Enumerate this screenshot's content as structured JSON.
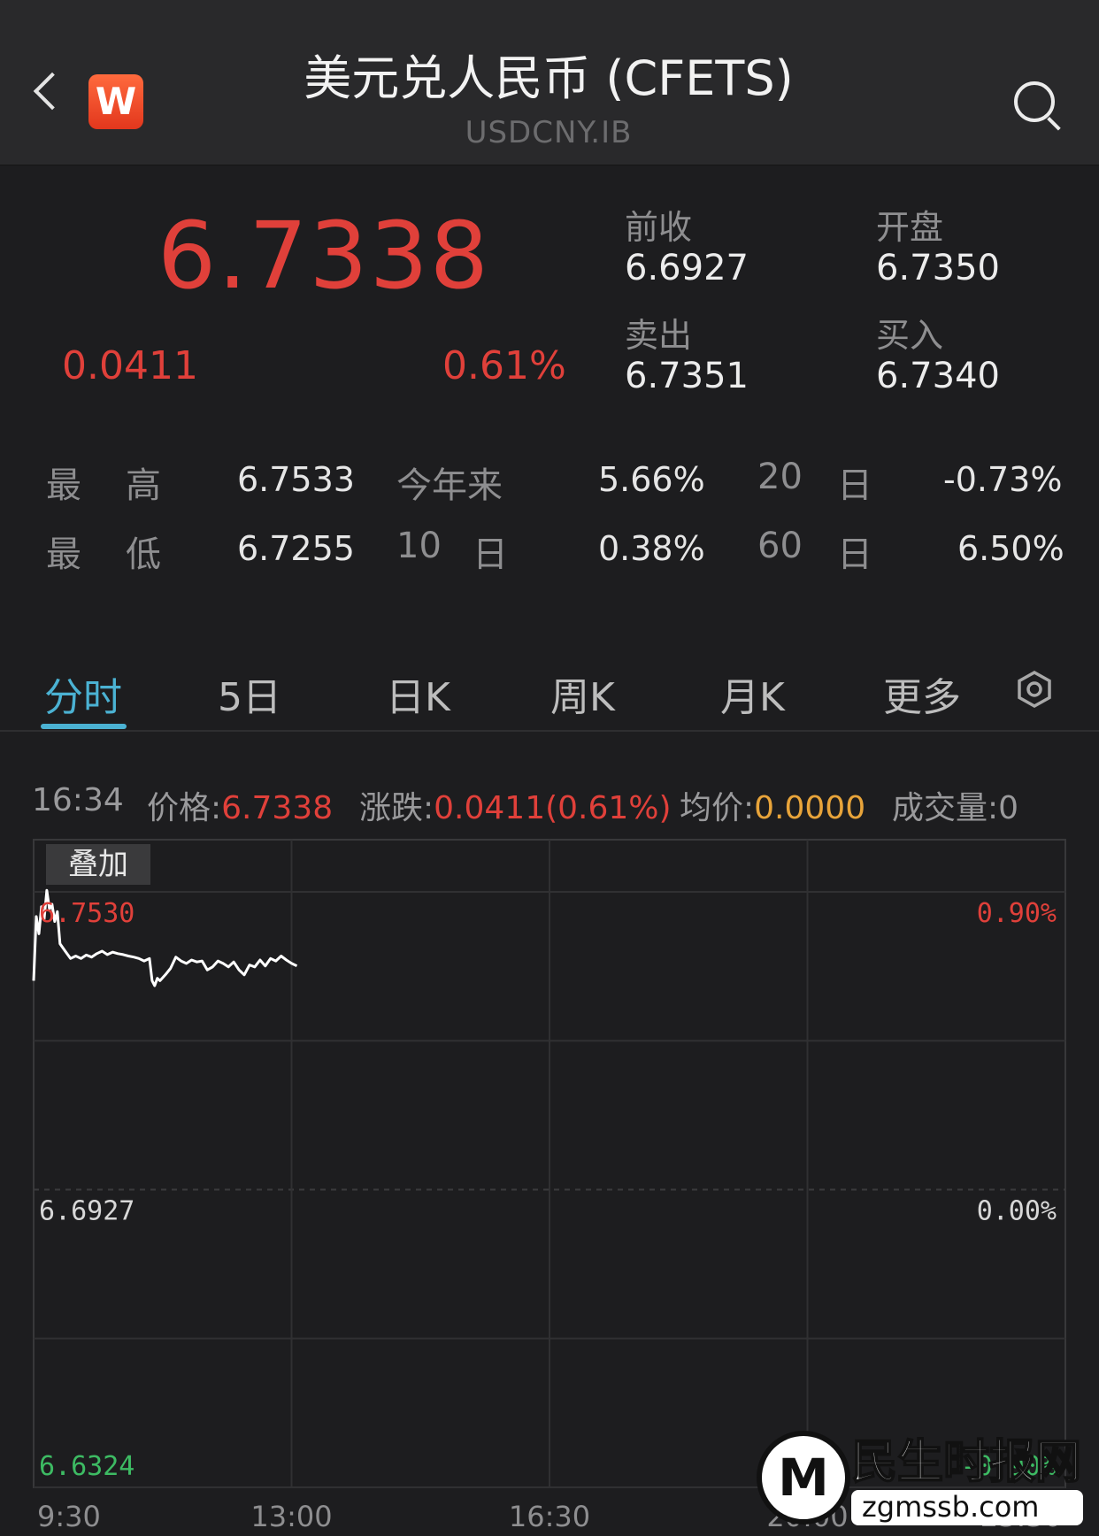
{
  "header": {
    "title": "美元兑人民币 (CFETS)",
    "subtitle": "USDCNY.IB",
    "logo_letter": "W"
  },
  "quote": {
    "price": "6.7338",
    "change": "0.0411",
    "change_pct": "0.61%",
    "prev_close_label": "前收",
    "prev_close": "6.6927",
    "open_label": "开盘",
    "open": "6.7350",
    "sell_label": "卖出",
    "sell": "6.7351",
    "buy_label": "买入",
    "buy": "6.7340"
  },
  "stats": {
    "high_label_a": "最",
    "high_label_b": "高",
    "high": "6.7533",
    "low_label_a": "最",
    "low_label_b": "低",
    "low": "6.7255",
    "ytd_label": "今年来",
    "ytd": "5.66%",
    "d10_num": "10",
    "d10_unit": "日",
    "d10": "0.38%",
    "d20_num": "20",
    "d20_unit": "日",
    "d20": "-0.73%",
    "d60_num": "60",
    "d60_unit": "日",
    "d60": "6.50%"
  },
  "tabs": [
    "分时",
    "5日",
    "日K",
    "周K",
    "月K",
    "更多"
  ],
  "info_line": {
    "time": "16:34",
    "price_label": "价格:",
    "price": "6.7338",
    "chg_label": "涨跌:",
    "chg": "0.0411(0.61%)",
    "avg_label": "均价:",
    "avg": "0.0000",
    "vol_label": "成交量:",
    "vol": "0"
  },
  "overlay_button": "叠加",
  "watermark": {
    "name": "民生时报网",
    "domain": "zgmssb.com"
  },
  "colors": {
    "up": "#e0403a",
    "down": "#3dbb63",
    "accent": "#4bb2d3",
    "avg": "#e8a43a"
  },
  "chart_data": {
    "type": "line",
    "y_labels_left": [
      "6.7530",
      "6.6927",
      "6.6324"
    ],
    "y_labels_right": [
      "0.90%",
      "0.00%",
      "-0.90%"
    ],
    "x_labels": [
      "9:30",
      "13:00",
      "16:30",
      "20:00",
      "23:30"
    ],
    "ylim": [
      6.6324,
      6.753
    ],
    "reference": 6.6927,
    "x": [
      0,
      1,
      2,
      3,
      4,
      5,
      6,
      7,
      8,
      9,
      10,
      12,
      14,
      16,
      18,
      20,
      22,
      24,
      26,
      28,
      30,
      32,
      34,
      36,
      38,
      40,
      42,
      44,
      45,
      46,
      47,
      48,
      50,
      52,
      54,
      56,
      58,
      60,
      62,
      64,
      66,
      68,
      70,
      72,
      74,
      76,
      78,
      80,
      82,
      84,
      86,
      88,
      90,
      92,
      94,
      96,
      98,
      100
    ],
    "series": [
      {
        "values": [
          6.735,
          6.748,
          6.7445,
          6.75,
          6.7475,
          6.7533,
          6.7495,
          6.7505,
          6.747,
          6.749,
          6.7425,
          6.741,
          6.7395,
          6.74,
          6.7395,
          6.7402,
          6.7398,
          6.7405,
          6.741,
          6.7403,
          6.7408,
          6.7405,
          6.7403,
          6.74,
          6.7398,
          6.7395,
          6.739,
          6.7395,
          6.735,
          6.734,
          6.7355,
          6.735,
          6.7362,
          6.7375,
          6.7398,
          6.739,
          6.7385,
          6.7392,
          6.7388,
          6.739,
          6.7372,
          6.7378,
          6.739,
          6.7385,
          6.7378,
          6.7388,
          6.7372,
          6.7362,
          6.7382,
          6.7378,
          6.7392,
          6.738,
          6.7395,
          6.739,
          6.74,
          6.7392,
          6.7385,
          6.738
        ]
      }
    ]
  }
}
